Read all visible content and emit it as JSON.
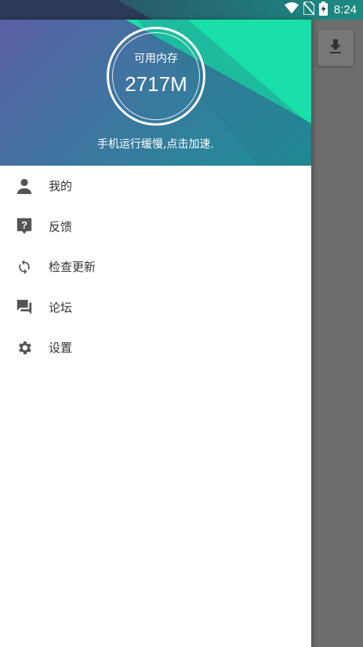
{
  "status_bar": {
    "time": "8:24",
    "icons": [
      "wifi-icon",
      "no-sim-icon",
      "battery-charging-icon"
    ]
  },
  "header": {
    "memory_label": "可用内存",
    "memory_value": "2717M",
    "hint": "手机运行缓慢,点击加速."
  },
  "menu": [
    {
      "label": "我的",
      "icon": "person-icon"
    },
    {
      "label": "反馈",
      "icon": "feedback-icon"
    },
    {
      "label": "检查更新",
      "icon": "sync-icon"
    },
    {
      "label": "论坛",
      "icon": "forum-icon"
    },
    {
      "label": "设置",
      "icon": "settings-icon"
    }
  ],
  "colors": {
    "header_start": "#5b5fa3",
    "header_end": "#1c9196",
    "accent_green": "#18e0a8",
    "scrim": "#6a6a6a",
    "icon_gray": "#555555"
  }
}
